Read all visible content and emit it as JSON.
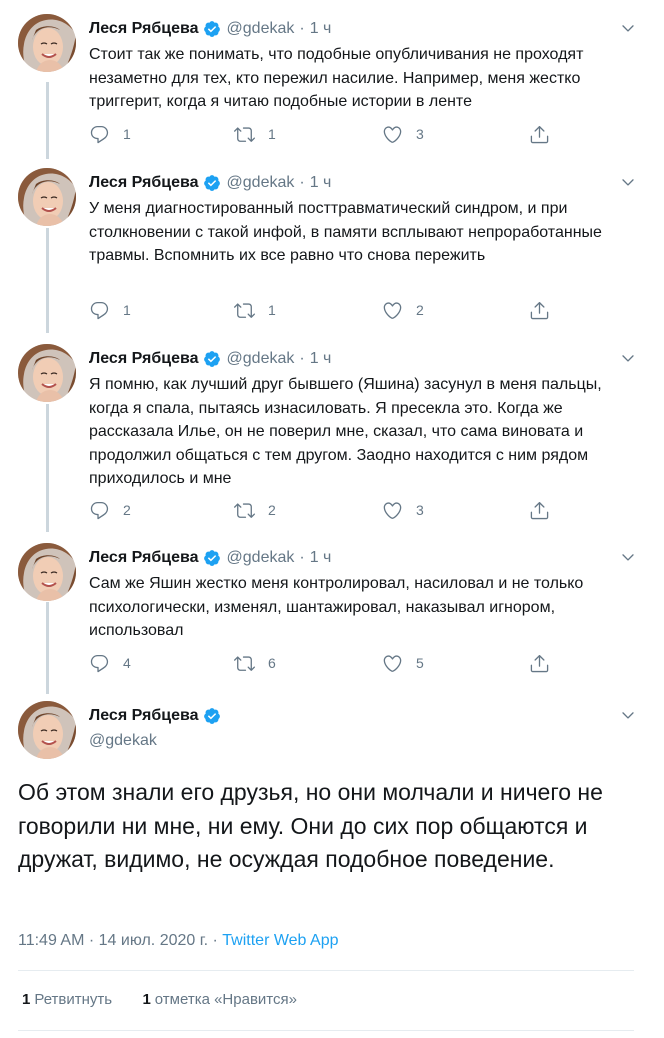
{
  "colors": {
    "accent": "#1da1f2",
    "muted": "#657786",
    "text": "#14171a",
    "line": "#ccd6dd"
  },
  "author": {
    "name": "Леся Рябцева",
    "handle": "@gdekak",
    "verified": true
  },
  "thread": [
    {
      "time": "1 ч",
      "text": "Стоит так же понимать, что подобные опубличивания не проходят незаметно для тех, кто пережил насилие. Например, меня жестко триггерит, когда я читаю подобные истории в ленте",
      "replies": "1",
      "retweets": "1",
      "likes": "3"
    },
    {
      "time": "1 ч",
      "text": "У меня диагностированный посттравматический синдром, и при столкновении с такой инфой, в памяти всплывают непроработанные травмы. Вспомнить их все равно что снова пережить",
      "replies": "1",
      "retweets": "1",
      "likes": "2"
    },
    {
      "time": "1 ч",
      "text": "Я помню, как лучший друг бывшего (Яшина) засунул в меня пальцы, когда я спала, пытаясь изнасиловать. Я пресекла это. Когда же рассказала Илье, он не поверил мне, сказал, что сама виновата и продолжил общаться с тем другом. Заодно находится с ним рядом приходилось и мне",
      "replies": "2",
      "retweets": "2",
      "likes": "3"
    },
    {
      "time": "1 ч",
      "text": "Сам же Яшин жестко меня контролировал, насиловал и не только психологически, изменял, шантажировал, наказывал игнором, использовал",
      "replies": "4",
      "retweets": "6",
      "likes": "5"
    }
  ],
  "main_tweet": {
    "text": "Об этом знали его друзья, но они молчали и ничего не говорили ни мне, ни ему. Они до сих пор общаются и дружат, видимо, не осуждая подобное поведение.",
    "timestamp": "11:49 AM · 14 июл. 2020 г.",
    "separator": " · ",
    "source": "Twitter Web App",
    "retweets_count": "1",
    "retweets_label": "Ретвитнуть",
    "likes_count": "1",
    "likes_label": "отметка «Нравится»"
  },
  "icons": {
    "reply": "reply-icon",
    "retweet": "retweet-icon",
    "like": "heart-icon",
    "share": "share-icon",
    "caret": "chevron-down-icon",
    "verified": "verified-badge-icon"
  }
}
